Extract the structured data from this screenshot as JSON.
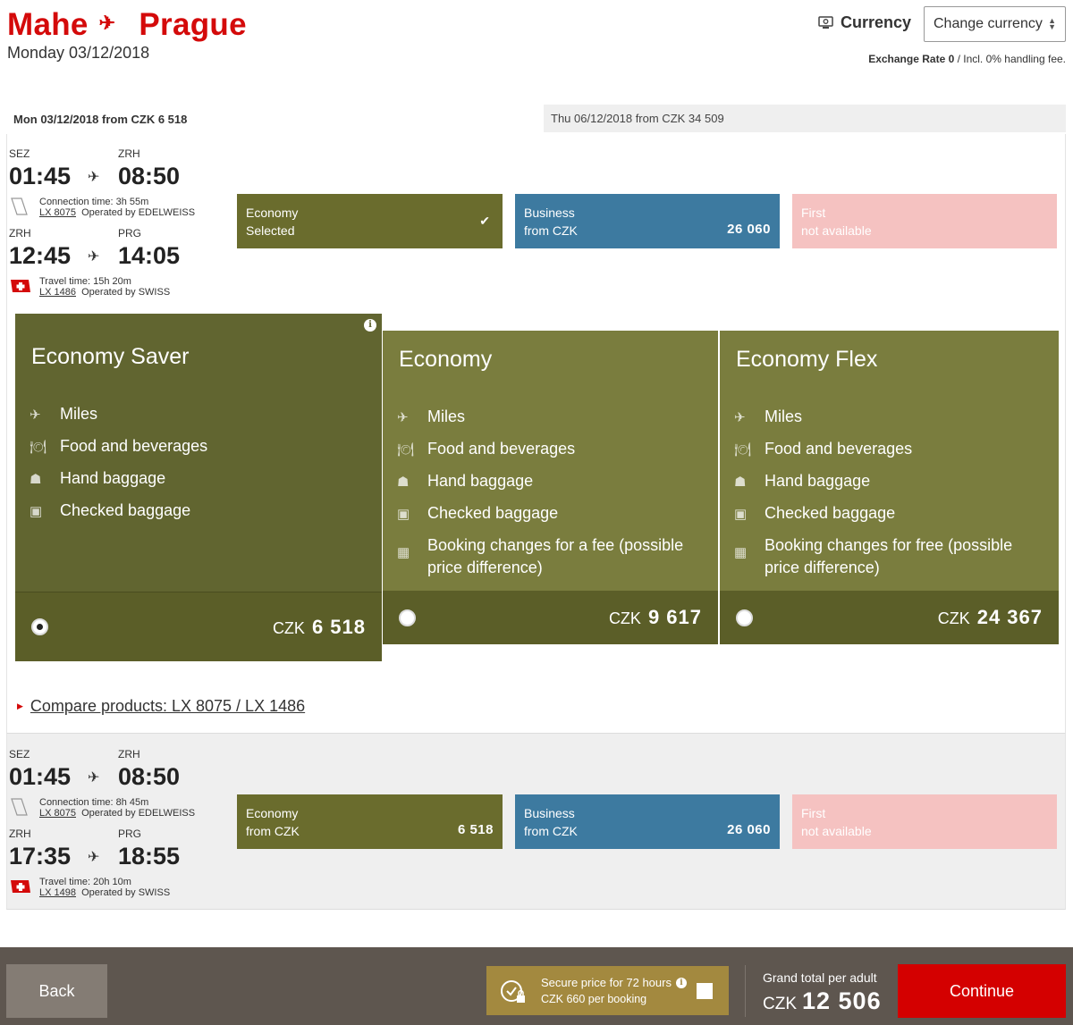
{
  "header": {
    "origin": "Mahe",
    "destination": "Prague",
    "date": "Monday 03/12/2018",
    "currency_label": "Currency",
    "currency_select": "Change currency",
    "exchange_rate": "Exchange Rate 0",
    "exchange_note": " / Incl. 0% handling fee."
  },
  "date_tabs": {
    "active": "Mon 03/12/2018 from CZK  6  518",
    "other": "Thu 06/12/2018 from CZK  34  509"
  },
  "flight1": {
    "seg1": {
      "from_code": "SEZ",
      "to_code": "ZRH",
      "dep": "01:45",
      "arr": "08:50",
      "info_line1": "Connection time: 3h 55m",
      "flight_no": "LX 8075",
      "operator": "Operated by EDELWEISS"
    },
    "seg2": {
      "from_code": "ZRH",
      "to_code": "PRG",
      "dep": "12:45",
      "arr": "14:05",
      "info_line1": "Travel time: 15h 20m",
      "flight_no": "LX 1486",
      "operator": "Operated by SWISS"
    },
    "cabins": {
      "economy": {
        "name": "Economy",
        "sub": "Selected"
      },
      "business": {
        "name": "Business",
        "sub": "from CZK",
        "price": "26  060"
      },
      "first": {
        "name": "First",
        "sub": "not available"
      }
    }
  },
  "fares": {
    "saver": {
      "title": "Economy Saver",
      "features": [
        "Miles",
        "Food and beverages",
        "Hand baggage",
        "Checked baggage"
      ],
      "currency": "CZK",
      "price": "6  518"
    },
    "economy": {
      "title": "Economy",
      "features": [
        "Miles",
        "Food and beverages",
        "Hand baggage",
        "Checked baggage",
        "Booking changes for a fee (possible price difference)"
      ],
      "currency": "CZK",
      "price": "9  617"
    },
    "flex": {
      "title": "Economy Flex",
      "features": [
        "Miles",
        "Food and beverages",
        "Hand baggage",
        "Checked baggage",
        "Booking changes for free (possible price difference)"
      ],
      "currency": "CZK",
      "price": "24  367"
    }
  },
  "compare_link": "Compare products: LX 8075 / LX 1486",
  "flight2": {
    "seg1": {
      "from_code": "SEZ",
      "to_code": "ZRH",
      "dep": "01:45",
      "arr": "08:50",
      "info_line1": "Connection time: 8h 45m",
      "flight_no": "LX 8075",
      "operator": "Operated by EDELWEISS"
    },
    "seg2": {
      "from_code": "ZRH",
      "to_code": "PRG",
      "dep": "17:35",
      "arr": "18:55",
      "info_line1": "Travel time: 20h 10m",
      "flight_no": "LX 1498",
      "operator": "Operated by SWISS"
    },
    "cabins": {
      "economy": {
        "name": "Economy",
        "sub": "from CZK",
        "price": "6  518"
      },
      "business": {
        "name": "Business",
        "sub": "from CZK",
        "price": "26  060"
      },
      "first": {
        "name": "First",
        "sub": "not available"
      }
    }
  },
  "bottom": {
    "back": "Back",
    "secure_title": "Secure price for 72 hours",
    "secure_sub": "CZK  660 per booking",
    "grand_label": "Grand total per adult",
    "grand_currency": "CZK",
    "grand_amount": "12  506",
    "continue": "Continue"
  },
  "colors": {
    "brand_red": "#d40a0a",
    "economy_green": "#6a6c2d",
    "business_blue": "#3d7aa0",
    "first_pink": "#f5c2c1"
  }
}
